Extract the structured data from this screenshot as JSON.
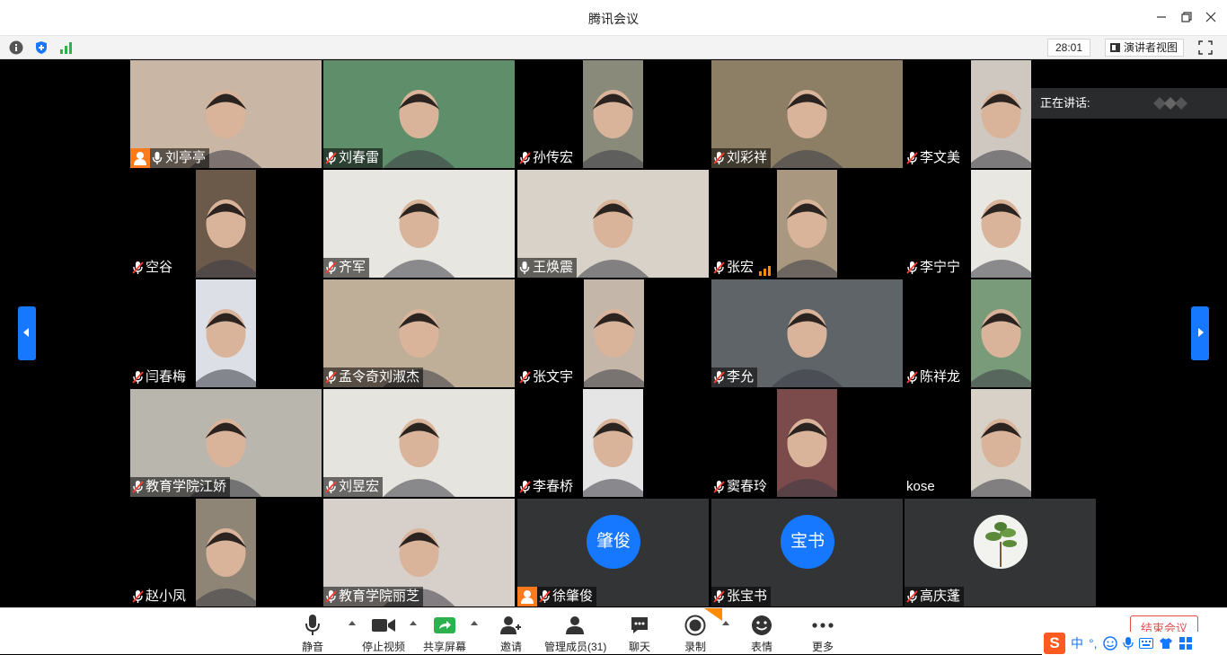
{
  "window": {
    "title": "腾讯会议"
  },
  "infobar": {
    "timer": "28:01",
    "presenter_view_label": "演讲者视图"
  },
  "stage": {
    "speaking_label": "正在讲话:"
  },
  "participants": [
    {
      "name": "刘亭亭",
      "mic": "on",
      "host": true
    },
    {
      "name": "刘春雷",
      "mic": "muted"
    },
    {
      "name": "孙传宏",
      "mic": "muted"
    },
    {
      "name": "刘彩祥",
      "mic": "muted"
    },
    {
      "name": "李文美",
      "mic": "muted"
    },
    {
      "name": "空谷",
      "mic": "muted"
    },
    {
      "name": "齐军",
      "mic": "muted"
    },
    {
      "name": "王焕震",
      "mic": "on"
    },
    {
      "name": "张宏",
      "mic": "muted",
      "signal": true
    },
    {
      "name": "李宁宁",
      "mic": "muted"
    },
    {
      "name": "闫春梅",
      "mic": "muted"
    },
    {
      "name": "孟令奇刘淑杰",
      "mic": "muted"
    },
    {
      "name": "张文宇",
      "mic": "muted"
    },
    {
      "name": "李允",
      "mic": "muted"
    },
    {
      "name": "陈祥龙",
      "mic": "muted"
    },
    {
      "name": "教育学院江娇",
      "mic": "muted"
    },
    {
      "name": "刘昱宏",
      "mic": "muted"
    },
    {
      "name": "李春桥",
      "mic": "muted"
    },
    {
      "name": "窦春玲",
      "mic": "muted"
    },
    {
      "name": "kose",
      "mic": "none"
    },
    {
      "name": "赵小凤",
      "mic": "muted"
    },
    {
      "name": "教育学院丽芝",
      "mic": "muted"
    },
    {
      "name": "徐肇俊",
      "mic": "muted",
      "host": true,
      "avatar_text": "肇俊"
    },
    {
      "name": "张宝书",
      "mic": "muted",
      "avatar_text": "宝书"
    },
    {
      "name": "高庆蓬",
      "mic": "muted",
      "photo_avatar": true
    }
  ],
  "toolbar": {
    "mute": "静音",
    "stop_video": "停止视频",
    "share_screen": "共享屏幕",
    "invite": "邀请",
    "manage_members": "管理成员(31)",
    "chat": "聊天",
    "record": "录制",
    "reaction": "表情",
    "more": "更多",
    "end_meeting": "结束会议"
  },
  "ime": {
    "mode": "中"
  },
  "colors": {
    "accent": "#1677ff",
    "host": "#ff7a1a",
    "end": "#e34d4d"
  }
}
